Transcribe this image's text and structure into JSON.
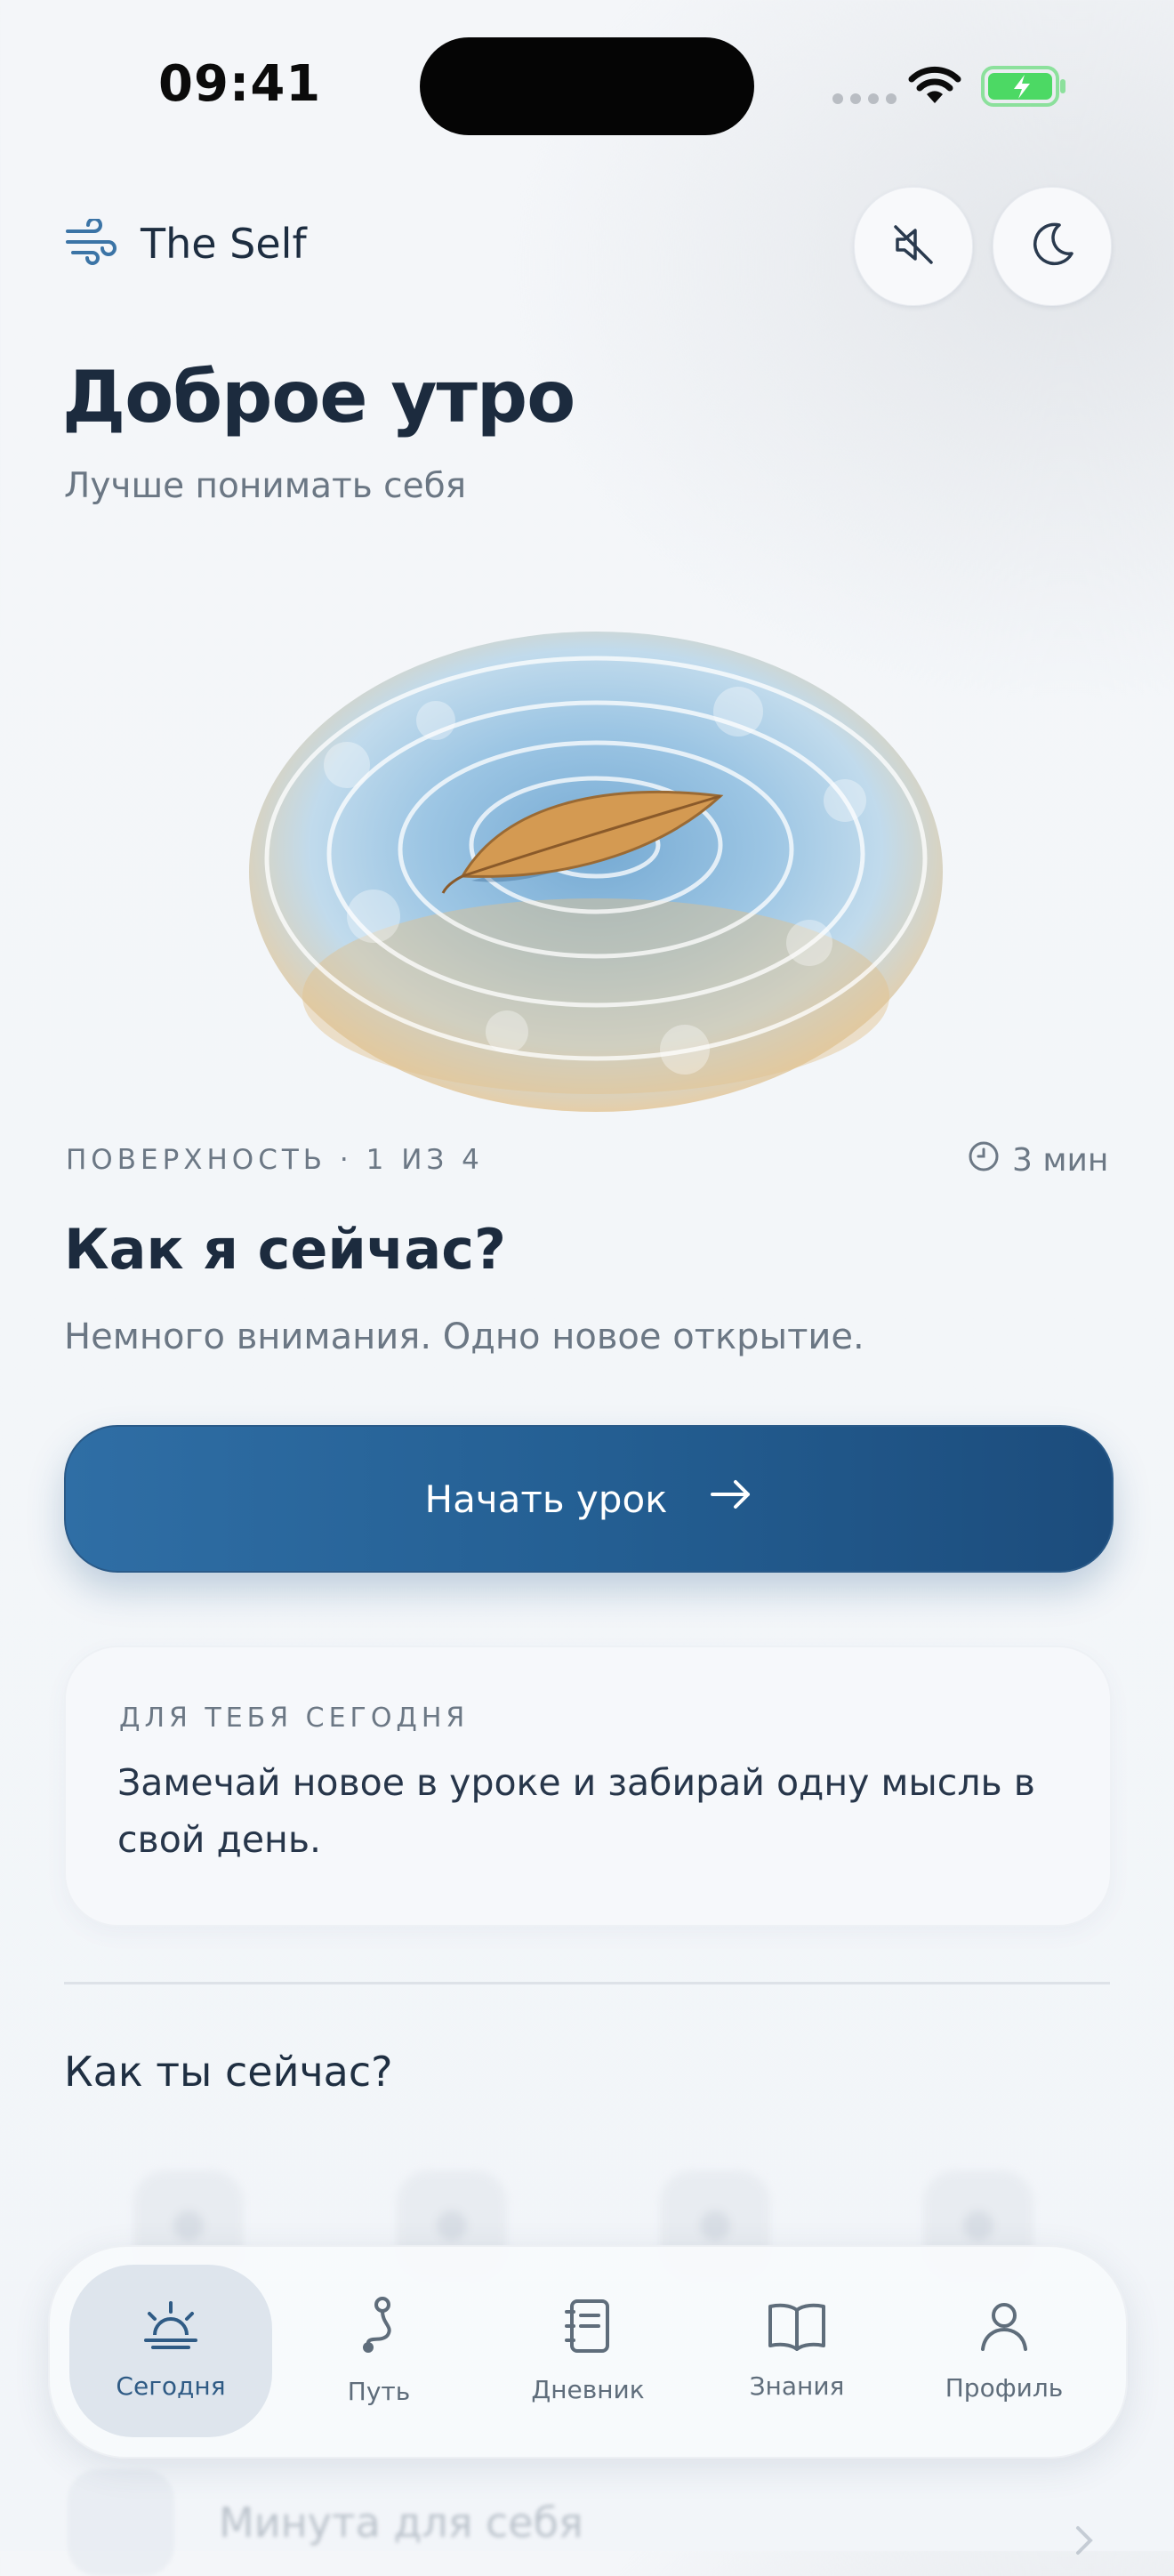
{
  "status_bar": {
    "time": "09:41"
  },
  "header": {
    "brand": "The Self"
  },
  "greeting": "Доброе утро",
  "subtitle": "Лучше понимать себя",
  "lesson": {
    "meta": "ПОВЕРХНОСТЬ · 1 ИЗ 4",
    "duration": "3 мин",
    "title": "Как я сейчас?",
    "description": "Немного внимания. Одно новое открытие.",
    "start_label": "Начать урок"
  },
  "today_card": {
    "label": "ДЛЯ ТЕБЯ СЕГОДНЯ",
    "text": "Замечай новое в уроке и забирай одну мысль в свой день."
  },
  "mood": {
    "title": "Как ты сейчас?"
  },
  "faded_item": {
    "label": "Минута для себя"
  },
  "tabs": [
    {
      "label": "Сегодня",
      "icon": "sunrise-icon",
      "active": true
    },
    {
      "label": "Путь",
      "icon": "path-icon",
      "active": false
    },
    {
      "label": "Дневник",
      "icon": "journal-icon",
      "active": false
    },
    {
      "label": "Знания",
      "icon": "book-icon",
      "active": false
    },
    {
      "label": "Профиль",
      "icon": "profile-icon",
      "active": false
    }
  ],
  "colors": {
    "accent": "#2f6ea5",
    "accent_dark": "#1c4c7c",
    "text_primary": "#1c2b3e",
    "text_secondary": "#6b7784",
    "battery_green": "#4cd964"
  }
}
